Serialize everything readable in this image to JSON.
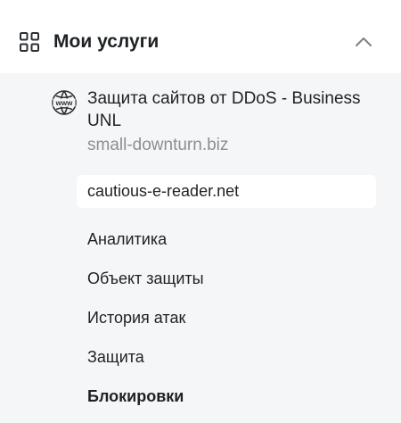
{
  "header": {
    "title": "Мои услуги",
    "icon": "grid-icon",
    "toggle_icon": "chevron-up-icon",
    "expanded": true
  },
  "service": {
    "icon": "www-globe-icon",
    "icon_text": "www",
    "name": "Защита сайтов от DDoS - Business UNL",
    "domain": "small-downturn.biz"
  },
  "selected_domain": "cautious-e-reader.net",
  "menu": {
    "items": [
      {
        "label": "Аналитика"
      },
      {
        "label": "Объект защиты"
      },
      {
        "label": "История атак"
      },
      {
        "label": "Защита"
      },
      {
        "label": "Блокировки"
      }
    ],
    "active_label": "Блокировки"
  },
  "colors": {
    "page_background": "#f5f6f7",
    "header_background": "#ffffff",
    "text": "#1e2124",
    "muted_text": "#8b8f94"
  }
}
